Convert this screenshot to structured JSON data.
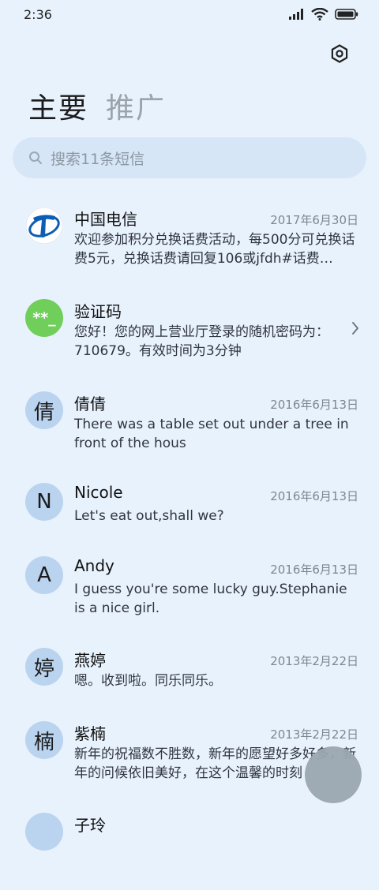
{
  "status_bar": {
    "time": "2:36"
  },
  "tabs": [
    {
      "label": "主要"
    },
    {
      "label": "推广"
    }
  ],
  "search": {
    "placeholder": "搜索11条短信"
  },
  "messages": [
    {
      "name": "中国电信",
      "date": "2017年6月30日",
      "preview": "欢迎参加积分兑换话费活动，每500分可兑换话费5元，兑换话费请回复106或jfdh#话费…",
      "avatar_text": "",
      "avatar_color": "#ffffff"
    },
    {
      "name": "验证码",
      "date": "",
      "preview": "您好！您的网上营业厅登录的随机密码为：710679。有效时间为3分钟",
      "avatar_text": "**_",
      "avatar_color": "#6fcf5a"
    },
    {
      "name": "倩倩",
      "date": "2016年6月13日",
      "preview": "There was a table set out under a tree in front of the hous",
      "avatar_text": "倩",
      "avatar_color": "#bad3ef"
    },
    {
      "name": "Nicole",
      "date": "2016年6月13日",
      "preview": "Let's eat out,shall we?",
      "avatar_text": "N",
      "avatar_color": "#bad3ef"
    },
    {
      "name": "Andy",
      "date": "2016年6月13日",
      "preview": "I guess you're some lucky guy.Stephanie is a nice girl.",
      "avatar_text": "A",
      "avatar_color": "#bad3ef"
    },
    {
      "name": "燕婷",
      "date": "2013年2月22日",
      "preview": "嗯。收到啦。同乐同乐。",
      "avatar_text": "婷",
      "avatar_color": "#bad3ef"
    },
    {
      "name": "紫楠",
      "date": "2013年2月22日",
      "preview": "新年的祝福数不胜数，新年的愿望好多好多，新年的问候依旧美好，在这个温馨的时刻",
      "avatar_text": "楠",
      "avatar_color": "#bad3ef"
    },
    {
      "name": "子玲",
      "date": "",
      "preview": "",
      "avatar_text": "",
      "avatar_color": "#bad3ef"
    }
  ],
  "icons": {
    "settings": "settings-icon",
    "search": "search-icon",
    "chevron": "chevron-right-icon",
    "signal": "signal-icon",
    "wifi": "wifi-icon",
    "battery": "battery-icon"
  }
}
